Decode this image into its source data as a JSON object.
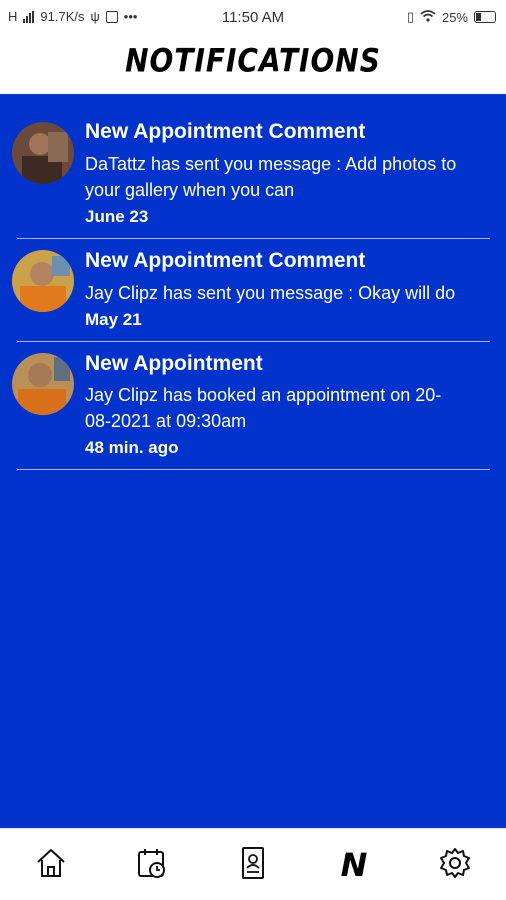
{
  "status_bar": {
    "network": "H",
    "speed": "91.7K/s",
    "more": "•••",
    "time": "11:50 AM",
    "battery": "25%"
  },
  "header": {
    "title": "NOTIFICATIONS"
  },
  "notifications": [
    {
      "title": "New Appointment Comment",
      "message": "DaTattz  has sent you message : Add photos to your gallery when you can",
      "date": "June 23"
    },
    {
      "title": "New Appointment Comment",
      "message": "Jay Clipz has sent you message : Okay will do",
      "date": "May 21"
    },
    {
      "title": "New Appointment",
      "message": "Jay Clipz has booked an appointment on 20-08-2021 at 09:30am",
      "date": "48 min. ago"
    }
  ],
  "bottom_nav": {
    "items": [
      {
        "icon": "home-icon"
      },
      {
        "icon": "calendar-clock-icon"
      },
      {
        "icon": "id-card-icon"
      },
      {
        "icon": "notifications-n-icon",
        "label": "N"
      },
      {
        "icon": "gear-icon"
      }
    ]
  },
  "colors": {
    "main_background": "#0033cc",
    "text": "#ffffff",
    "divider": "#9fb3ff"
  }
}
